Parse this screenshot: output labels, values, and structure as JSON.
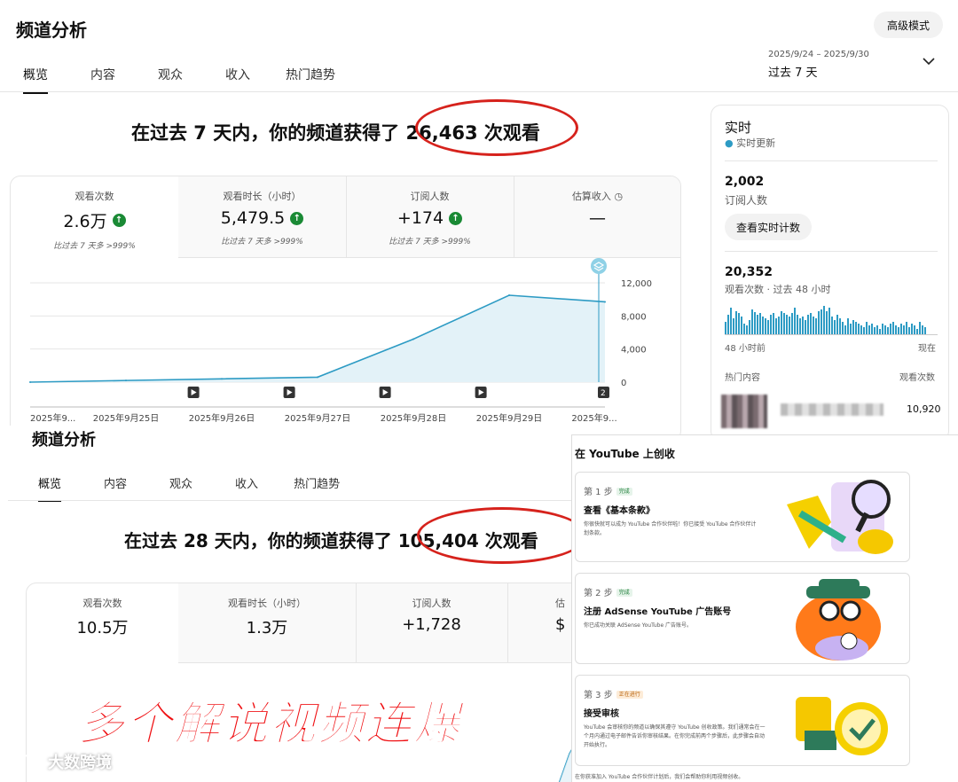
{
  "top": {
    "title": "频道分析",
    "advanced_label": "高级模式",
    "tabs": [
      "概览",
      "内容",
      "观众",
      "收入",
      "热门趋势"
    ],
    "date_range": "2025/9/24 – 2025/9/30",
    "date_label": "过去 7 天",
    "headline_prefix": "在过去 7 天内，你的频道获得了",
    "headline_views": "26,463 次观看",
    "metrics": [
      {
        "label": "观看次数",
        "value": "2.6万",
        "compare": "比过去 7 天多 >999%"
      },
      {
        "label": "观看时长（小时）",
        "value": "5,479.5",
        "compare": "比过去 7 天多 >999%"
      },
      {
        "label": "订阅人数",
        "value": "+174",
        "compare": "比过去 7 天多 >999%"
      },
      {
        "label": "估算收入",
        "value": "—"
      }
    ],
    "y_ticks": [
      "12,000",
      "8,000",
      "4,000",
      "0"
    ],
    "x_ticks": [
      "2025年9...",
      "2025年9月25日",
      "2025年9月26日",
      "2025年9月27日",
      "2025年9月28日",
      "2025年9月29日",
      "2025年9..."
    ],
    "video_count_badge": "2"
  },
  "chart_data": {
    "type": "area",
    "x": [
      "2025年9月24日",
      "2025年9月25日",
      "2025年9月26日",
      "2025年9月27日",
      "2025年9月28日",
      "2025年9月29日",
      "2025年9月30日"
    ],
    "series": [
      {
        "values": [
          0,
          200,
          400,
          600,
          5200,
          10500,
          9700
        ]
      }
    ],
    "ylim": [
      0,
      12000
    ],
    "y_ticks": [
      0,
      4000,
      8000,
      12000
    ]
  },
  "realtime": {
    "title": "实时",
    "live_label": "实时更新",
    "subs_value": "2,002",
    "subs_label": "订阅人数",
    "realtime_btn": "查看实时计数",
    "views_value": "20,352",
    "views_label": "观看次数 · 过去 48 小时",
    "axis_left": "48 小时前",
    "axis_right": "现在",
    "top_content_label": "热门内容",
    "views_col_label": "观看次数",
    "top_item_views": "10,920"
  },
  "bottom": {
    "title": "频道分析",
    "tabs": [
      "概览",
      "内容",
      "观众",
      "收入",
      "热门趋势"
    ],
    "headline_prefix": "在过去 28 天内，你的频道获得了",
    "headline_views": "105,404 次观看",
    "metrics": [
      {
        "label": "观看次数",
        "value": "10.5万"
      },
      {
        "label": "观看时长（小时）",
        "value": "1.3万"
      },
      {
        "label": "订阅人数",
        "value": "+1,728"
      },
      {
        "label": "估",
        "value": "$"
      }
    ]
  },
  "monetize": {
    "title": "在 YouTube 上创收",
    "steps": [
      {
        "step": "第 1 步",
        "badge": "完成",
        "title": "查看《基本条款》",
        "desc": "你很快就可以成为 YouTube 合作伙伴啦！你已接受 YouTube 合作伙伴计划条款。"
      },
      {
        "step": "第 2 步",
        "badge": "完成",
        "title": "注册 AdSense YouTube 广告账号",
        "desc": "你已成功关联 AdSense YouTube 广告账号。"
      },
      {
        "step": "第 3 步",
        "badge": "正在进行",
        "title": "接受审核",
        "desc": "YouTube 会审核你的频道以确保其遵守 YouTube 创收政策。我们通常会在一个月内通过电子邮件告诉你审核结果。在你完成前两个步骤后，此步骤会自动开始执行。"
      }
    ],
    "footer": "在你获准加入 YouTube 合作伙伴计划后，我们会帮助你利用视频创收。"
  },
  "overlay": {
    "caption": "多个解说视频连爆",
    "watermark": "大数跨境"
  },
  "colors": {
    "accent_red": "#ef0f12",
    "chart_line": "#2d9bc4",
    "up_green": "#1a8a35",
    "badge_green": "#e6f4ea",
    "badge_orange": "#fdecd8"
  }
}
